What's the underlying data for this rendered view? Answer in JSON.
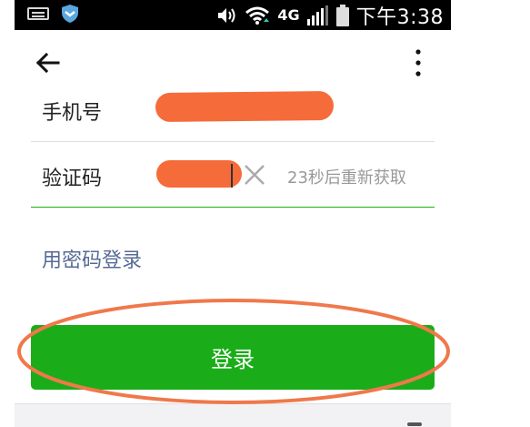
{
  "status_bar": {
    "network": "4G",
    "time": "下午3:38"
  },
  "icons": {
    "keyboard": "keyboard-icon",
    "shield": "shield-icon",
    "volume": "volume-icon",
    "wifi": "wifi-icon",
    "signal": "signal-icon",
    "battery": "battery-icon",
    "back": "arrow-left-icon",
    "more": "more-vertical-icon",
    "clear": "close-icon"
  },
  "form": {
    "phone_label": "手机号",
    "phone_value_redacted": true,
    "code_label": "验证码",
    "code_value_redacted": true,
    "resend_text": "23秒后重新获取"
  },
  "password_login_link": "用密码登录",
  "login_button": "登录",
  "colors": {
    "primary_green": "#1aad19",
    "link_blue": "#576b95",
    "redaction_orange": "#f56b3a",
    "annotation_orange": "#f0784a"
  }
}
